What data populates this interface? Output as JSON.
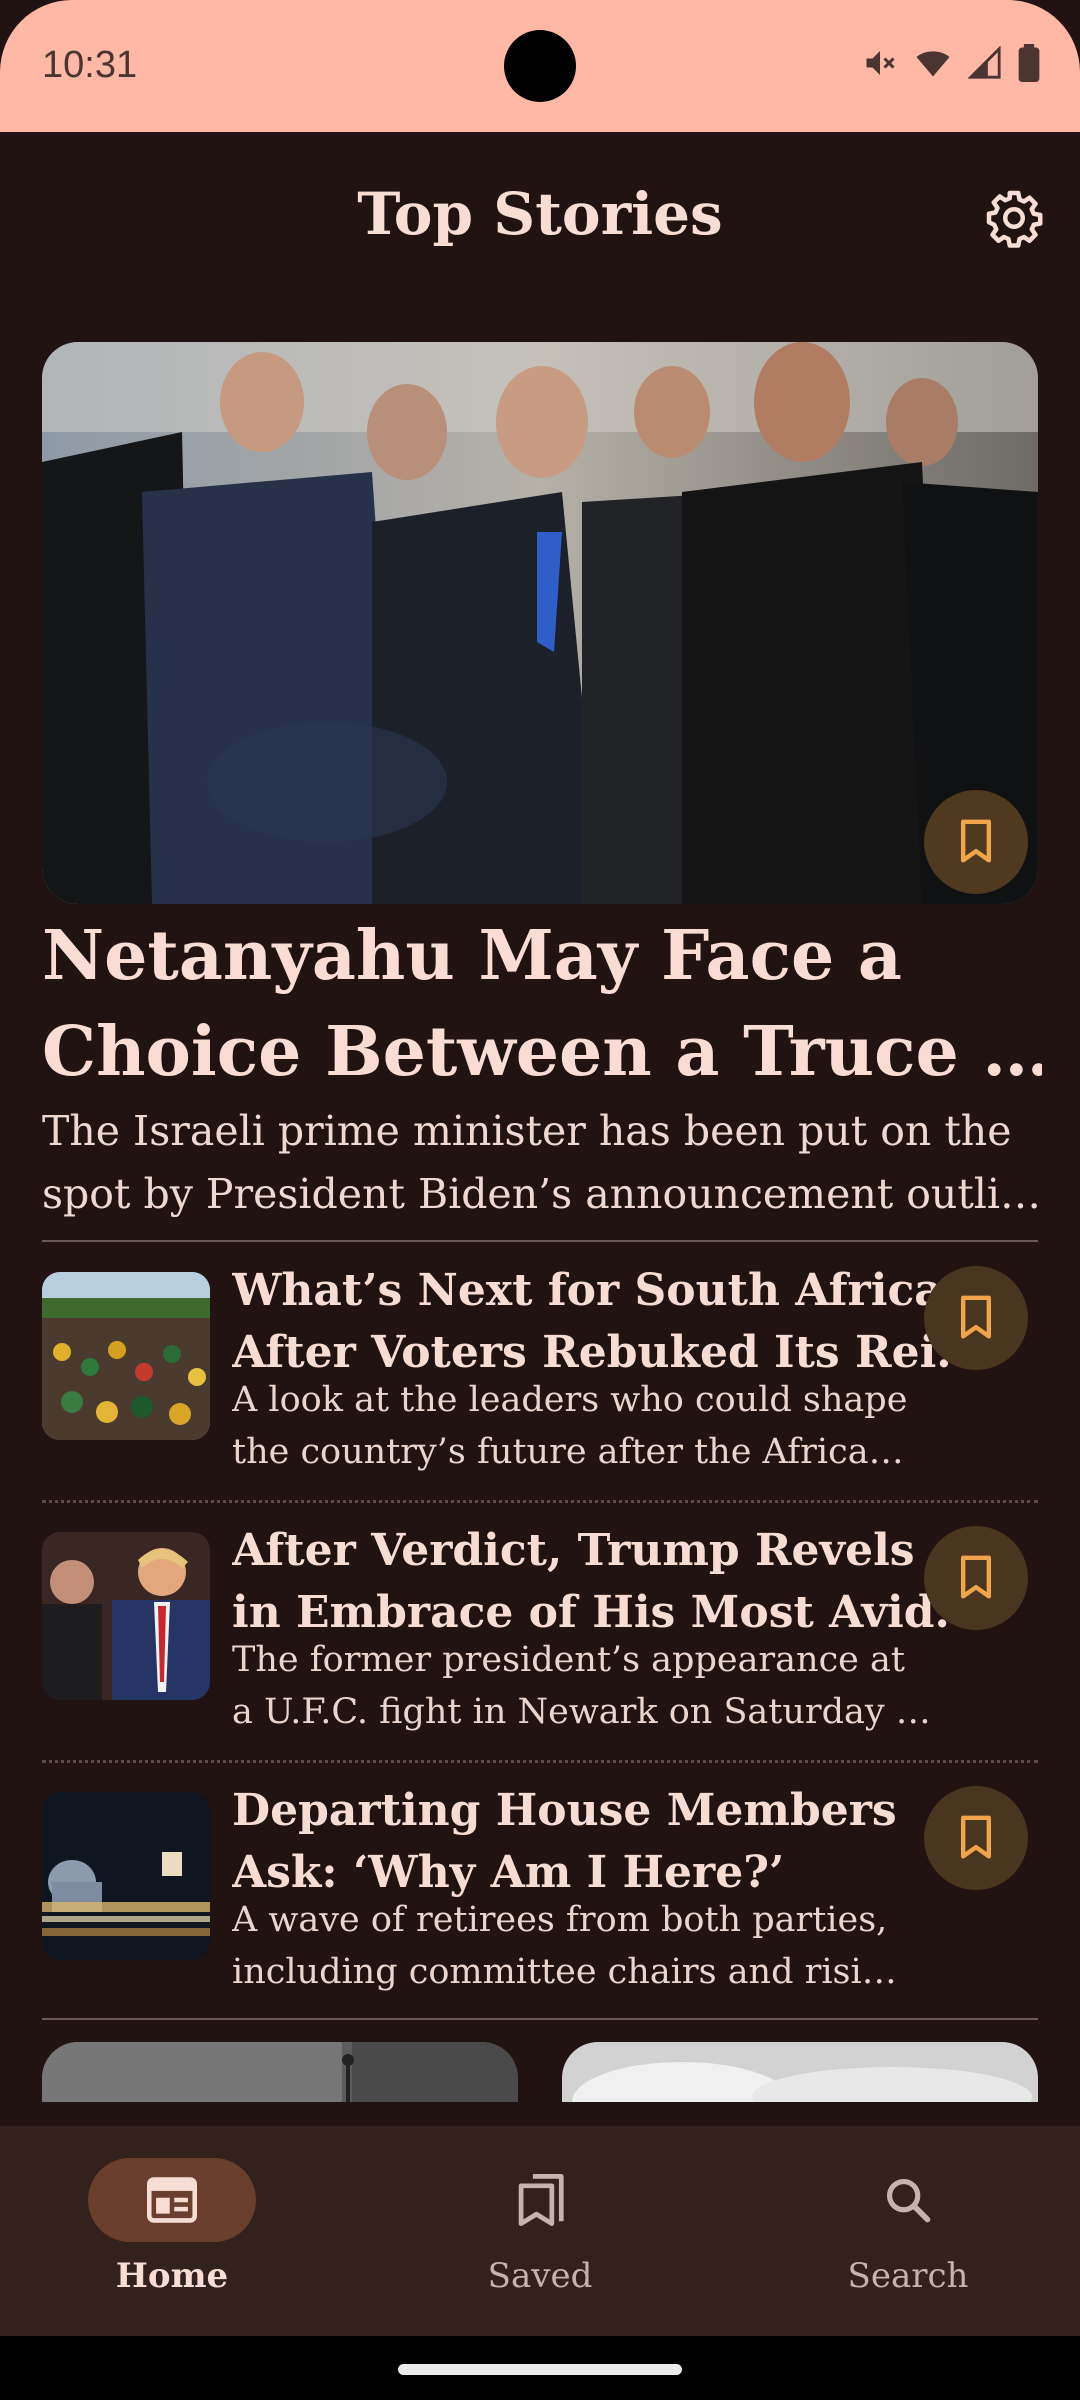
{
  "status_bar": {
    "time": "10:31",
    "icons": [
      "mute-icon",
      "wifi-icon",
      "signal-icon",
      "battery-icon"
    ]
  },
  "header": {
    "title": "Top Stories",
    "settings_icon": "gear-icon"
  },
  "hero": {
    "title_lines": [
      "Netanyahu May Face a",
      "Choice Between a Truce …"
    ],
    "summary_lines": [
      "The Israeli prime minister has been put on the",
      "spot by President Biden’s announcement outli…"
    ],
    "bookmark_icon": "bookmark-icon"
  },
  "stories": [
    {
      "title_lines": [
        "What’s Next for South Africa",
        "After Voters Rebuked Its Rei…"
      ],
      "summary_lines": [
        "A look at the leaders who could shape",
        "the country’s future after the Africa…"
      ],
      "bookmark_icon": "bookmark-icon"
    },
    {
      "title_lines": [
        "After Verdict, Trump Revels",
        "in Embrace of His Most Avid…"
      ],
      "summary_lines": [
        "The former president’s appearance at",
        "a U.F.C. fight in Newark on Saturday …"
      ],
      "bookmark_icon": "bookmark-icon"
    },
    {
      "title_lines": [
        "Departing House Members",
        "Ask: ‘Why Am I Here?’"
      ],
      "summary_lines": [
        "A wave of retirees from both parties,",
        "including committee chairs and risi…"
      ],
      "bookmark_icon": "bookmark-icon"
    }
  ],
  "nav": {
    "items": [
      {
        "label": "Home",
        "icon": "newspaper-icon",
        "active": true
      },
      {
        "label": "Saved",
        "icon": "bookmarks-icon",
        "active": false
      },
      {
        "label": "Search",
        "icon": "search-icon",
        "active": false
      }
    ]
  },
  "colors": {
    "background": "#201312",
    "status_bar": "#ffb8a6",
    "bookmark_bg": "#4f3a1f",
    "bookmark_fg": "#f0a54a",
    "nav_bg": "#33211e",
    "nav_active_pill": "#6b3f2d"
  }
}
